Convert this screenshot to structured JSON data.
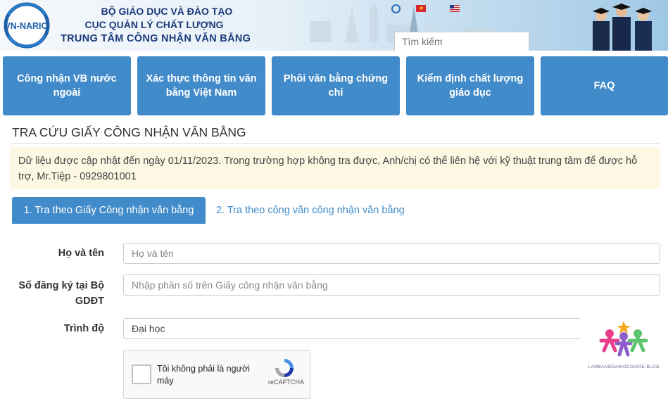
{
  "header": {
    "logo_text": "VN-NARIC",
    "org_line1": "BỘ GIÁO DỤC VÀ ĐÀO TẠO",
    "org_line2": "CỤC QUẢN LÝ CHẤT LƯỢNG",
    "org_line3": "TRUNG TÂM CÔNG NHẬN VĂN BẰNG",
    "search_placeholder": "Tìm kiếm"
  },
  "nav": {
    "items": [
      {
        "label": "Công nhận VB nước ngoài"
      },
      {
        "label": "Xác thực thông tin văn bằng Việt Nam"
      },
      {
        "label": "Phôi văn bằng chứng chỉ"
      },
      {
        "label": "Kiểm định chất lượng giáo dục"
      },
      {
        "label": "FAQ"
      }
    ]
  },
  "page": {
    "title": "TRA CỨU GIẤY CÔNG NHẬN VĂN BẰNG",
    "notice": "Dữ liệu được cập nhật đến ngày 01/11/2023. Trong trường hợp không tra được, Anh/chị có thể liên hệ với kỹ thuật trung tâm để được hỗ trợ, Mr.Tiệp - 0929801001"
  },
  "tabs": [
    {
      "label": "1. Tra theo Giấy Công nhận văn bằng",
      "active": true
    },
    {
      "label": "2. Tra theo công văn công nhận văn bằng",
      "active": false
    }
  ],
  "form": {
    "name_label": "Họ và tên",
    "name_placeholder": "Họ và tên",
    "reg_label_line1": "Số đăng ký tại Bộ",
    "reg_label_line2": "GDĐT",
    "reg_placeholder": "Nhập phần số trên Giấy công nhận văn bằng",
    "level_label": "Trình độ",
    "level_value": "Đại học"
  },
  "captcha": {
    "text": "Tôi không phải là người máy",
    "brand": "reCAPTCHA"
  },
  "watermark": {
    "text": "LAMBANGDAIHOCGIARE.BLOG"
  },
  "colors": {
    "primary": "#428bca",
    "notice_bg": "#fcf8e3",
    "header_text": "#1b3a7a"
  }
}
